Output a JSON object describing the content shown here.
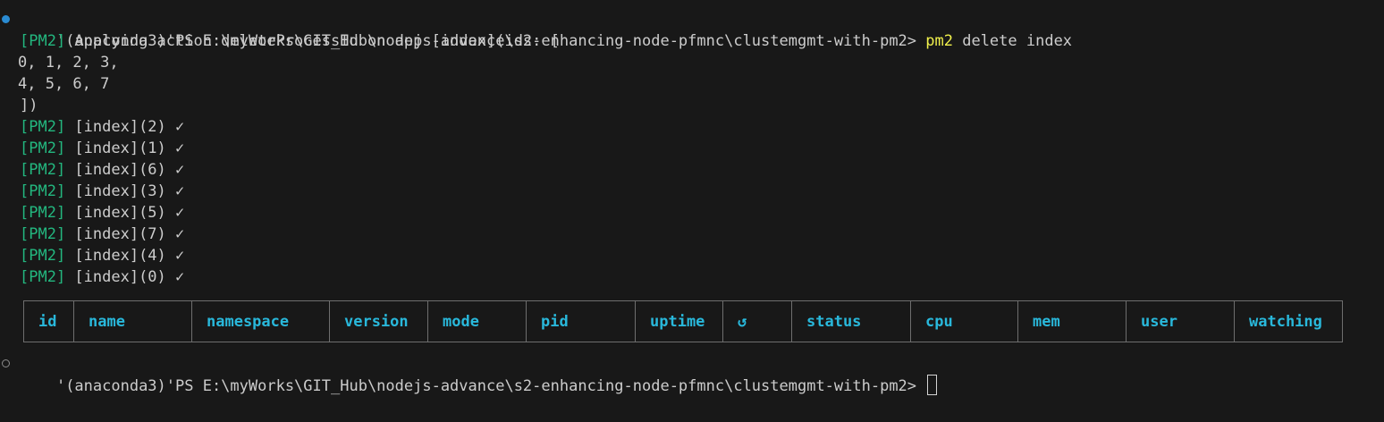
{
  "prompt": {
    "text": "'(anaconda3)'PS E:\\myWorks\\GIT_Hub\\nodejs-advance\\s2-enhancing-node-pfmnc\\clustemgmt-with-pm2> "
  },
  "command": {
    "program": "pm2",
    "args": " delete index"
  },
  "output": {
    "tag": "[PM2]",
    "action_text": " Applying action deleteProcessId on app [index](ids: [",
    "ids_line_1": "0, 1, 2, 3,",
    "ids_line_2": "4, 5, 6, 7",
    "close_bracket": "])",
    "deleted": [
      " [index](2) ✓",
      " [index](1) ✓",
      " [index](6) ✓",
      " [index](3) ✓",
      " [index](5) ✓",
      " [index](7) ✓",
      " [index](4) ✓",
      " [index](0) ✓"
    ]
  },
  "table": {
    "columns": [
      "id",
      "name",
      "namespace",
      "version",
      "mode",
      "pid",
      "uptime",
      "↺",
      "status",
      "cpu",
      "mem",
      "user",
      "watching"
    ]
  },
  "colors": {
    "background": "#181818",
    "command": "#f1f14c",
    "pm2_tag": "#23b77f",
    "table_header": "#29b8db",
    "decoration_success": "#2a8bd2"
  }
}
